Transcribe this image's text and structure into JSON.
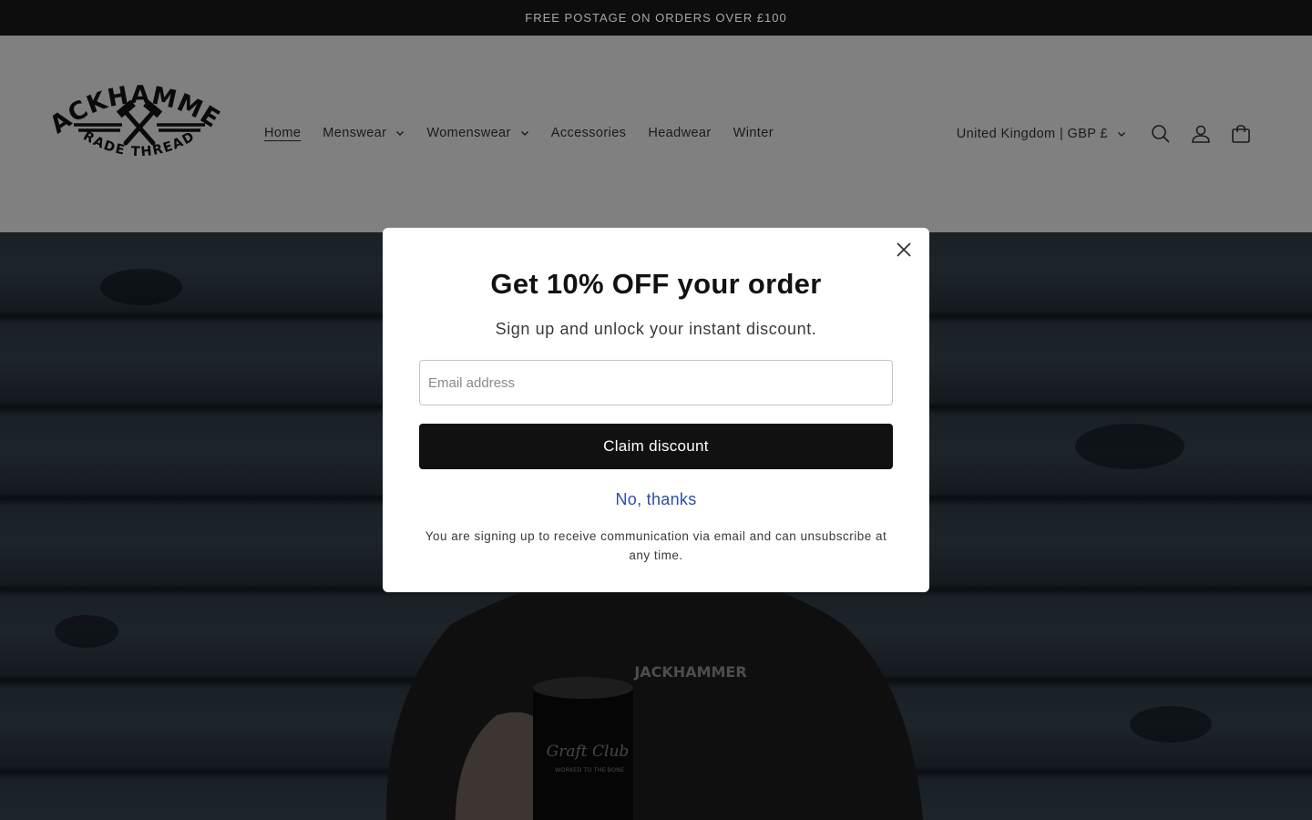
{
  "announcement": {
    "text": "FREE POSTAGE ON ORDERS OVER £100"
  },
  "logo": {
    "top_text": "JACKHAMMER",
    "bottom_text": "TRADE THREADS"
  },
  "nav": {
    "items": [
      {
        "label": "Home",
        "active": true,
        "has_dropdown": false
      },
      {
        "label": "Menswear",
        "active": false,
        "has_dropdown": true
      },
      {
        "label": "Womenswear",
        "active": false,
        "has_dropdown": true
      },
      {
        "label": "Accessories",
        "active": false,
        "has_dropdown": false
      },
      {
        "label": "Headwear",
        "active": false,
        "has_dropdown": false
      },
      {
        "label": "Winter",
        "active": false,
        "has_dropdown": false
      }
    ]
  },
  "header": {
    "country_selector": "United Kingdom | GBP £",
    "icons": [
      "search-icon",
      "account-icon",
      "cart-icon"
    ]
  },
  "hero": {
    "hoodie_text": "JACKHAMMER",
    "mug_text_1": "Graft Club",
    "mug_text_2": "WORKED TO THE BONE"
  },
  "popup": {
    "title": "Get 10% OFF your order",
    "subtitle": "Sign up and unlock your instant discount.",
    "email_placeholder": "Email address",
    "email_value": "",
    "submit_label": "Claim discount",
    "decline_label": "No, thanks",
    "fine_print": "You are signing up to receive communication via email and can unsubscribe at any time."
  },
  "colors": {
    "announcement_bg": "#0d0d0d",
    "header_bg": "#808080",
    "button_bg": "#111111",
    "link": "#2c4fa3"
  }
}
